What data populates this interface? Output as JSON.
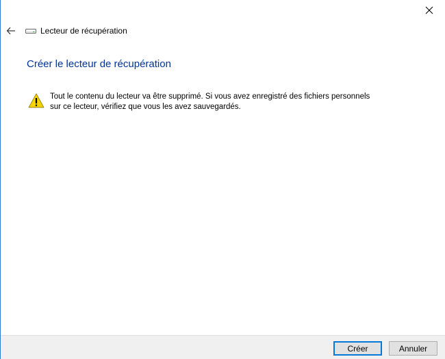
{
  "window": {
    "title": "Lecteur de récupération"
  },
  "header": {
    "back_icon": "back-arrow-icon",
    "drive_icon": "drive-icon",
    "close_icon": "close-icon"
  },
  "main": {
    "heading": "Créer le lecteur de récupération",
    "warning_icon": "warning-icon",
    "warning_line1": "Tout le contenu du lecteur va être supprimé. Si vous avez enregistré des fichiers personnels",
    "warning_line2": "sur ce lecteur, vérifiez que vous les avez sauvegardés."
  },
  "footer": {
    "create_label": "Créer",
    "cancel_label": "Annuler"
  },
  "colors": {
    "heading": "#003399",
    "accent": "#0078d7",
    "footer_bg": "#f0f0f0",
    "warning_yellow": "#f5d400"
  }
}
